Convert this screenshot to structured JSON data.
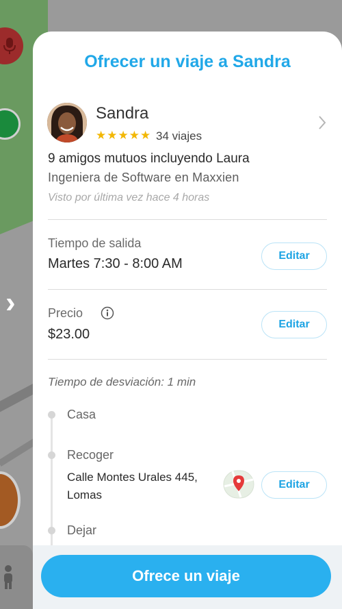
{
  "sheet": {
    "title": "Ofrecer un viaje a Sandra"
  },
  "profile": {
    "name": "Sandra",
    "rating_stars": "★★★★★",
    "trips": "34 viajes",
    "mutual_friends": "9 amigos mutuos incluyendo Laura",
    "job": "Ingeniera de Software en Maxxien",
    "last_seen": "Visto por última vez hace 4 horas"
  },
  "departure": {
    "label": "Tiempo de salida",
    "value": "Martes 7:30 - 8:00 AM",
    "edit_label": "Editar"
  },
  "price": {
    "label": "Precio",
    "value": "$23.00",
    "edit_label": "Editar"
  },
  "route": {
    "detour_text": "Tiempo de desviación: 1 min",
    "stops": {
      "home": {
        "label": "Casa"
      },
      "pickup": {
        "label": "Recoger",
        "address_line1": "Calle Montes Urales 445,",
        "address_line2": "Lomas",
        "edit_label": "Editar"
      },
      "dropoff": {
        "label": "Dejar"
      }
    }
  },
  "actions": {
    "offer_label": "Ofrece un viaje"
  },
  "colors": {
    "accent": "#21a8e8",
    "button_primary": "#2ab0ef",
    "star": "#f2b705"
  }
}
